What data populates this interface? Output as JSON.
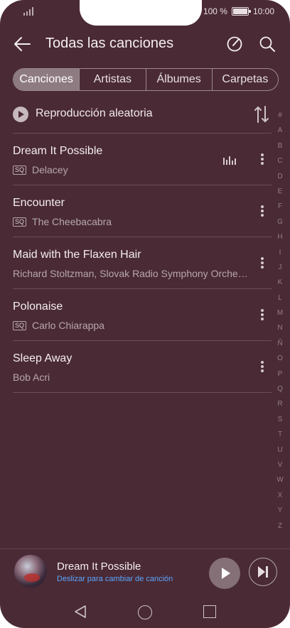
{
  "status": {
    "battery": "100 %",
    "time": "10:00"
  },
  "appbar": {
    "title": "Todas las canciones"
  },
  "tabs": [
    {
      "label": "Canciones",
      "active": true
    },
    {
      "label": "Artistas",
      "active": false
    },
    {
      "label": "Álbumes",
      "active": false
    },
    {
      "label": "Carpetas",
      "active": false
    }
  ],
  "shuffle": {
    "label": "Reproducción aleatoria"
  },
  "songs": [
    {
      "title": "Dream It Possible",
      "badge": "SQ",
      "artist": "Delacey",
      "playing": true
    },
    {
      "title": "Encounter",
      "badge": "SQ",
      "artist": "The Cheebacabra",
      "playing": false
    },
    {
      "title": "Maid with the Flaxen Hair",
      "badge": "",
      "artist": "Richard Stoltzman, Slovak Radio Symphony Orche…",
      "playing": false
    },
    {
      "title": "Polonaise",
      "badge": "SQ",
      "artist": "Carlo Chiarappa",
      "playing": false
    },
    {
      "title": "Sleep Away",
      "badge": "",
      "artist": "Bob Acri",
      "playing": false
    }
  ],
  "alphabet": [
    "#",
    "A",
    "B",
    "C",
    "D",
    "E",
    "F",
    "G",
    "H",
    "I",
    "J",
    "K",
    "L",
    "M",
    "N",
    "Ñ",
    "O",
    "P",
    "Q",
    "R",
    "S",
    "T",
    "U",
    "V",
    "W",
    "X",
    "Y",
    "Z"
  ],
  "player": {
    "song": "Dream It Possible",
    "hint": "Deslizar para cambiar de canción"
  },
  "colors": {
    "background": "#4a2a35",
    "accent_link": "#5aa6ff",
    "active_tab": "#8e7b82"
  },
  "icons": [
    "back-arrow-icon",
    "edit-circle-icon",
    "search-icon",
    "play-circle-icon",
    "sort-icon",
    "equalizer-icon",
    "more-vertical-icon",
    "play-icon",
    "skip-next-icon",
    "nav-back-icon",
    "nav-home-icon",
    "nav-recents-icon"
  ]
}
